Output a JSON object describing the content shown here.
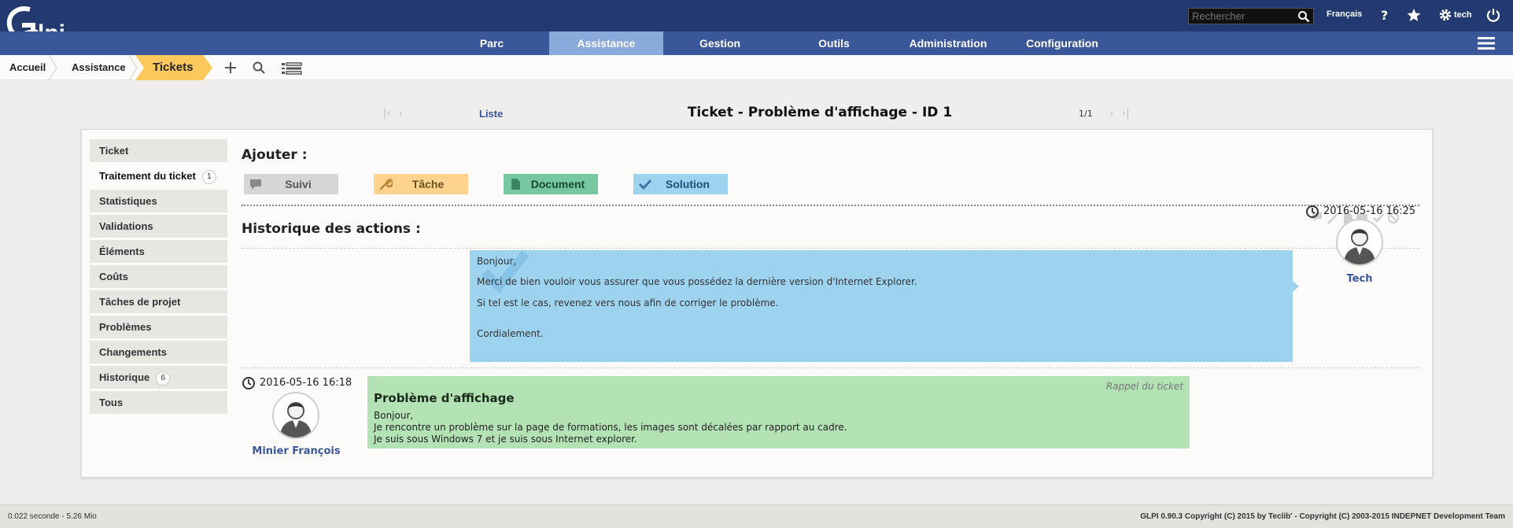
{
  "logo": {
    "text": "Glpi"
  },
  "header": {
    "search_placeholder": "Rechercher",
    "language": "Français",
    "user": "tech"
  },
  "menu": [
    {
      "label": "Parc"
    },
    {
      "label": "Assistance"
    },
    {
      "label": "Gestion"
    },
    {
      "label": "Outils"
    },
    {
      "label": "Administration"
    },
    {
      "label": "Configuration"
    }
  ],
  "breadcrumb": {
    "home": "Accueil",
    "section": "Assistance",
    "current": "Tickets"
  },
  "nav": {
    "list_label": "Liste",
    "title": "Ticket - Problème d'affichage - ID 1",
    "count": "1/1"
  },
  "tabs": [
    {
      "label": "Ticket",
      "badge": ""
    },
    {
      "label": "Traitement du ticket",
      "badge": "1"
    },
    {
      "label": "Statistiques",
      "badge": ""
    },
    {
      "label": "Validations",
      "badge": ""
    },
    {
      "label": "Éléments",
      "badge": ""
    },
    {
      "label": "Coûts",
      "badge": ""
    },
    {
      "label": "Tâches de projet",
      "badge": ""
    },
    {
      "label": "Problèmes",
      "badge": ""
    },
    {
      "label": "Changements",
      "badge": ""
    },
    {
      "label": "Historique",
      "badge": "6"
    },
    {
      "label": "Tous",
      "badge": ""
    }
  ],
  "add": {
    "title": "Ajouter :",
    "buttons": [
      {
        "label": "Suivi",
        "color": "#d6d6d6",
        "icon": "comment-icon"
      },
      {
        "label": "Tâche",
        "color": "#ffd28d",
        "icon": "wrench-icon"
      },
      {
        "label": "Document",
        "color": "#77c7a0",
        "icon": "document-icon"
      },
      {
        "label": "Solution",
        "color": "#9ed3f0",
        "icon": "check-icon"
      }
    ]
  },
  "history": {
    "title": "Historique des actions :",
    "solution": {
      "lines": [
        "Bonjour,",
        "Merci de bien vouloir vous assurer que vous possédez la dernière version d'Internet Explorer.",
        "Si tel est le cas, revenez vers nous afin de corriger le problème.",
        "Cordialement."
      ],
      "date": "2016-05-16 16:25",
      "author": "Tech"
    },
    "ticket": {
      "title": "Problème d'affichage",
      "recall": "Rappel du ticket",
      "lines": [
        "Bonjour,",
        "Je rencontre un problème sur la page de formations, les images sont décalées par rapport au cadre.",
        "Je suis sous Windows 7 et je suis sous Internet explorer."
      ],
      "date": "2016-05-16 16:18",
      "author": "Minier François"
    }
  },
  "footer": {
    "timing": "0.022 seconde - 5.26 Mio",
    "copyright": "GLPI 0.90.3 Copyright (C) 2015 by Teclib' - Copyright (C) 2003-2015 INDEPNET Development Team"
  }
}
